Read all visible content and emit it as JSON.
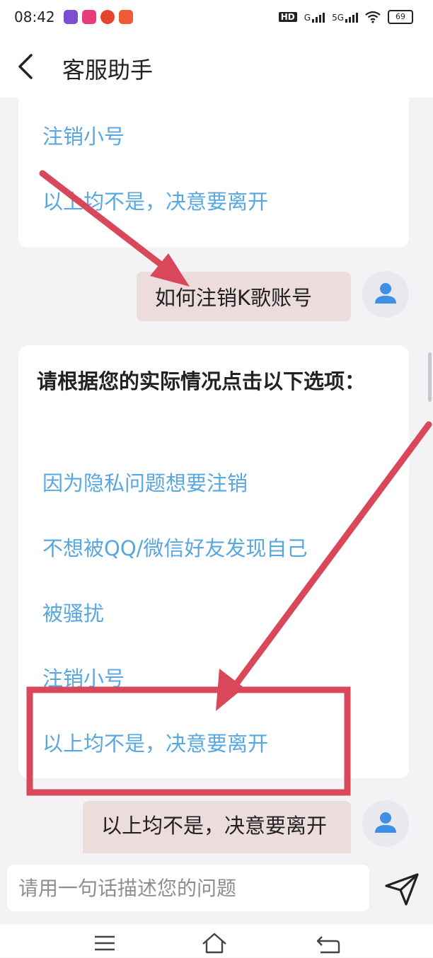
{
  "status_bar": {
    "time": "08:42",
    "network_hd": "HD",
    "network_g": "G",
    "network_5g": "5G",
    "battery": "69"
  },
  "header": {
    "title": "客服助手"
  },
  "chat": {
    "first_card_options": [
      "注销小号",
      "以上均不是，决意要离开"
    ],
    "user_message_1": "如何注销K歌账号",
    "second_card": {
      "prompt": "请根据您的实际情况点击以下选项：",
      "options": [
        "因为隐私问题想要注销",
        "不想被QQ/微信好友发现自己",
        "被骚扰",
        "注销小号",
        "以上均不是，决意要离开"
      ]
    },
    "user_message_2": "以上均不是，决意要离开"
  },
  "input": {
    "placeholder": "请用一句话描述您的问题"
  },
  "colors": {
    "option_link": "#59a7e0",
    "user_bubble": "#ecdcdc",
    "annotation_red": "#d9485a",
    "background": "#f3f3f5"
  },
  "icons": {
    "back": "chevron-left-icon",
    "avatar": "user-avatar-icon",
    "send": "paper-plane-icon",
    "menu": "menu-icon",
    "home": "home-icon",
    "return": "return-icon"
  }
}
